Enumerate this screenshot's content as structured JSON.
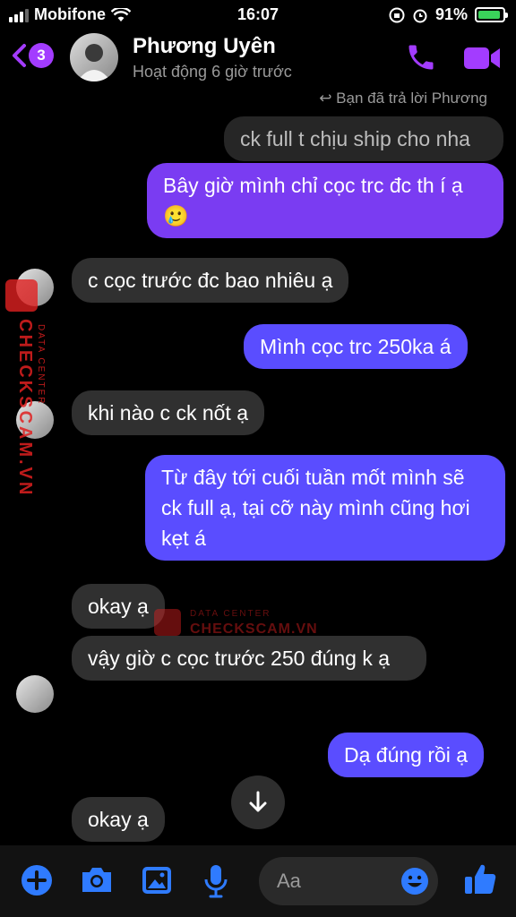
{
  "status_bar": {
    "carrier": "Mobifone",
    "time": "16:07",
    "battery": "91%",
    "battery_level": 0.91
  },
  "header": {
    "back_badge": "3",
    "name": "Phương Uyên",
    "status": "Hoạt động 6 giờ trước"
  },
  "reply_note": "Bạn đã trả lời Phương",
  "messages": [
    {
      "text": "ck full t chịu ship cho nha"
    },
    {
      "text": "Bây giờ mình chỉ cọc trc đc th í ạ🥲"
    },
    {
      "text": "c cọc trước đc bao nhiêu ạ"
    },
    {
      "text": "Mình cọc trc 250ka á"
    },
    {
      "text": "khi nào c ck nốt ạ"
    },
    {
      "text": "Từ đây tới cuối tuần mốt mình sẽ ck full ạ, tại cỡ này mình cũng hơi kẹt á"
    },
    {
      "text": "okay ạ"
    },
    {
      "text": "vậy giờ c cọc trước 250 đúng k ạ"
    },
    {
      "text": "Dạ đúng rồi ạ"
    },
    {
      "text": "okay ạ"
    }
  ],
  "watermark": {
    "center": "DATA CENTER",
    "brand": "CHECKSCAM.VN"
  },
  "composer": {
    "placeholder": "Aa"
  },
  "colors": {
    "accent": "#a33cff",
    "outgoing": "#5a4dff",
    "incoming": "#303030",
    "icon_blue": "#2f7bff",
    "watermark": "#e02020"
  }
}
